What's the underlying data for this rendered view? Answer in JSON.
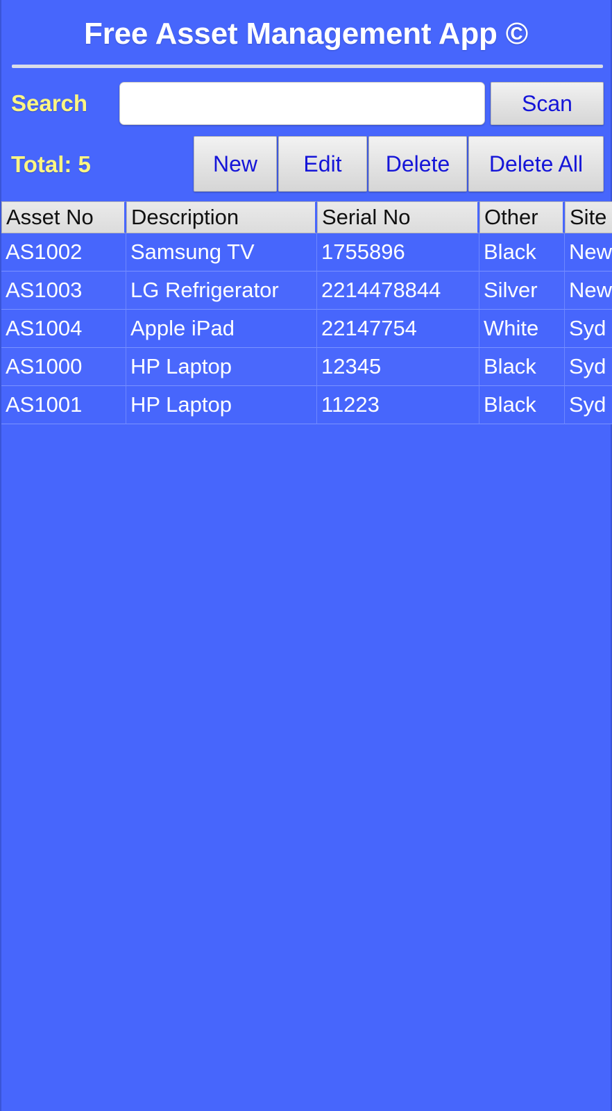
{
  "header": {
    "title": "Free Asset Management App ©"
  },
  "search": {
    "label": "Search",
    "value": "",
    "placeholder": "",
    "scan_label": "Scan"
  },
  "summary": {
    "total_label": "Total: 5"
  },
  "actions": {
    "new_label": "New",
    "edit_label": "Edit",
    "delete_label": "Delete",
    "delete_all_label": "Delete All"
  },
  "table": {
    "columns": [
      "Asset No",
      "Description",
      "Serial No",
      "Other",
      "Site"
    ],
    "rows": [
      {
        "asset_no": "AS1002",
        "description": "Samsung TV",
        "serial_no": "1755896",
        "other": "Black",
        "site": "New"
      },
      {
        "asset_no": "AS1003",
        "description": "LG Refrigerator",
        "serial_no": "2214478844",
        "other": "Silver",
        "site": "New"
      },
      {
        "asset_no": "AS1004",
        "description": "Apple iPad",
        "serial_no": "22147754",
        "other": "White",
        "site": "Syd"
      },
      {
        "asset_no": "AS1000",
        "description": "HP Laptop",
        "serial_no": "12345",
        "other": "Black",
        "site": "Syd"
      },
      {
        "asset_no": "AS1001",
        "description": "HP Laptop",
        "serial_no": "11223",
        "other": "Black",
        "site": "Syd"
      }
    ]
  },
  "colors": {
    "background": "#4766fc",
    "accent_yellow": "#fcf583",
    "button_text": "#1515d8",
    "header_text": "#ffffff"
  }
}
